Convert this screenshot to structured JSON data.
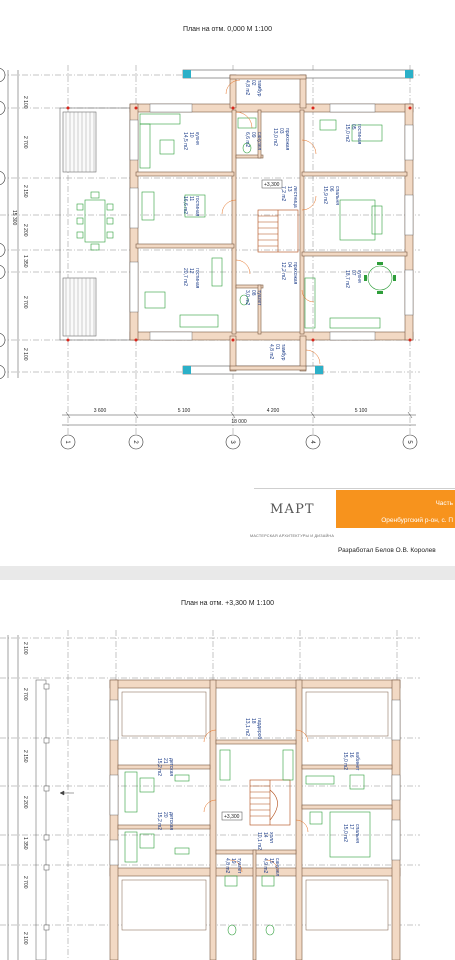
{
  "sheet1": {
    "title": "План на отм. 0,000 М 1:100",
    "dims_left": [
      "2 100",
      "2 700",
      "2 150",
      "2 200",
      "1 350",
      "2 700",
      "2 100"
    ],
    "dims_total_left": "15 300",
    "dims_bottom": [
      "3 600",
      "5 100",
      "4 200",
      "5 100"
    ],
    "dims_total_bottom": "18 000",
    "axes": [
      "1",
      "2",
      "3",
      "4",
      "5"
    ],
    "level_mark": "+3,300",
    "rooms": [
      {
        "name": "тамбур",
        "num": "02",
        "area": "4,8 m2"
      },
      {
        "name": "кухня",
        "num": "10",
        "area": "14,5 m2"
      },
      {
        "name": "санузел",
        "num": "09",
        "area": "6,6 m2"
      },
      {
        "name": "прихожая",
        "num": "03",
        "area": "13,0 m2"
      },
      {
        "name": "гостиная",
        "num": "05",
        "area": "15,0 m2"
      },
      {
        "name": "гостиная",
        "num": "11",
        "area": "16,6 m2"
      },
      {
        "name": "лестница",
        "num": "13",
        "area": "7,2 m2"
      },
      {
        "name": "спальня",
        "num": "06",
        "area": "15,9 m2"
      },
      {
        "name": "гостиная",
        "num": "12",
        "area": "20,7 m2"
      },
      {
        "name": "прихожая",
        "num": "04",
        "area": "12,2 m2"
      },
      {
        "name": "кухня",
        "num": "07",
        "area": "18,7 m2"
      },
      {
        "name": "туалет",
        "num": "08",
        "area": "3,0 m2"
      },
      {
        "name": "тамбур",
        "num": "01",
        "area": "4,8 m2"
      }
    ]
  },
  "stamp": {
    "line1": "Часть",
    "line2": "Оренбургский р-он, с. П",
    "logo": "МАРТ",
    "logo_sub": "МАСТЕРСКАЯ АРХИТЕКТУРЫ И ДИЗАЙНА",
    "author": "Разработал Белов О.В. Королев"
  },
  "sheet2": {
    "title": "План на отм. +3,300 М 1:100",
    "dims_left": [
      "2 100",
      "2 700",
      "2 150",
      "2 200",
      "1 350",
      "2 700",
      "2 100"
    ],
    "level_mark": "+3,300",
    "rooms": [
      {
        "name": "гардероб",
        "num": "18",
        "area": "13,1 m2"
      },
      {
        "name": "детская",
        "num": "21",
        "area": "15,2 m2"
      },
      {
        "name": "кабинет",
        "num": "16",
        "area": "15,0 m2"
      },
      {
        "name": "детская",
        "num": "20",
        "area": "15,2 m2"
      },
      {
        "name": "холл",
        "num": "14",
        "area": "10,1 m2"
      },
      {
        "name": "спальня",
        "num": "17",
        "area": "15,0 m2"
      },
      {
        "name": "туалет",
        "num": "19",
        "area": "4,8 m2"
      },
      {
        "name": "санузел",
        "num": "15",
        "area": "4,9 m2"
      }
    ]
  }
}
